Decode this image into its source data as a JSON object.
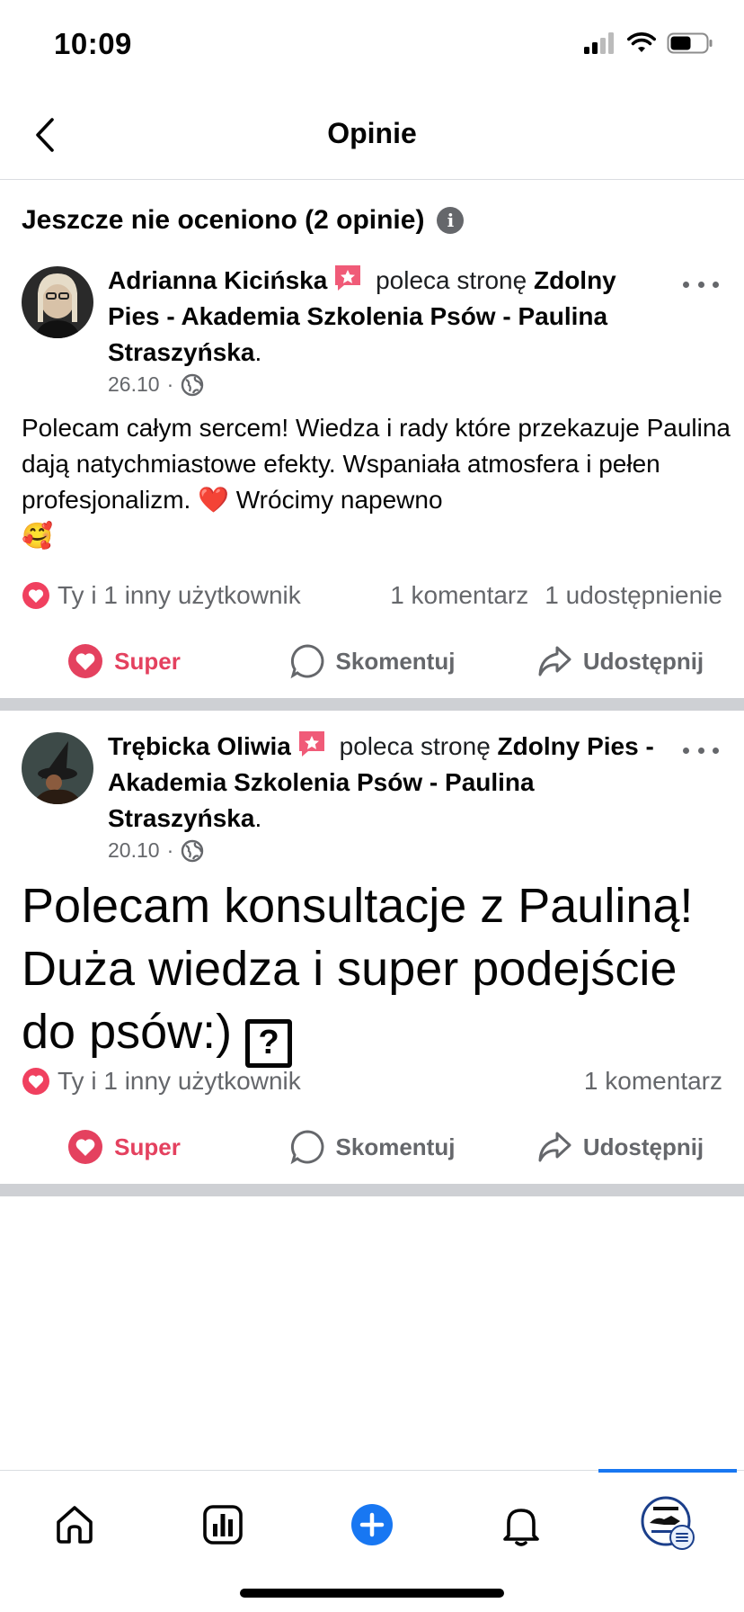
{
  "status": {
    "time": "10:09"
  },
  "header": {
    "title": "Opinie"
  },
  "section": {
    "title": "Jeszcze nie oceniono (2 opinie)"
  },
  "posts": [
    {
      "author": "Adrianna Kicińska",
      "recommends": "poleca stronę",
      "page": "Zdolny Pies - Akademia Szkolenia Psów - Paulina Straszyńska",
      "date": "26.10",
      "text_part1": "Polecam całym sercem! Wiedza i rady które przekazuje Paulina dają natychmiastowe efekty. Wspaniała atmosfera i pełen profesjonalizm.",
      "text_part2": "Wrócimy napewno",
      "emoji1": "❤️",
      "emoji2": "🥰",
      "reactions": "Ty i 1 inny użytkownik",
      "comments": "1 komentarz",
      "shares": "1 udostępnienie"
    },
    {
      "author": "Trębicka Oliwia",
      "recommends": "poleca stronę",
      "page": "Zdolny Pies - Akademia Szkolenia Psów - Paulina Straszyńska",
      "date": "20.10",
      "text": "Polecam konsultacje z Pauliną! Duża wiedza i super podejście do psów:)",
      "text_glyph": "?",
      "reactions": "Ty i 1 inny użytkownik",
      "comments": "1 komentarz"
    }
  ],
  "actions": {
    "like": "Super",
    "comment": "Skomentuj",
    "share": "Udostępnij"
  },
  "tabs": [
    "home-icon",
    "insights-icon",
    "create-icon",
    "notifications-icon",
    "profile-avatar"
  ],
  "colors": {
    "accent": "#1877f2",
    "love": "#e4415f",
    "muted": "#65676b",
    "divider": "#ced0d4"
  }
}
